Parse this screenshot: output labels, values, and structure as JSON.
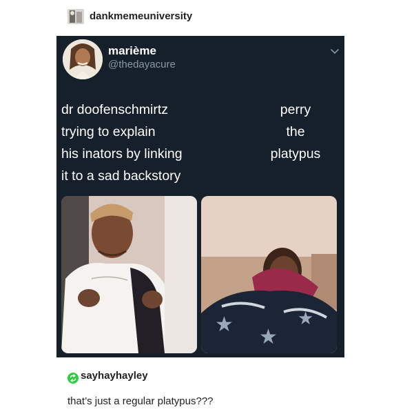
{
  "blog": {
    "name": "dankmemeuniversity"
  },
  "tweet": {
    "display_name": "marième",
    "handle": "@thedayacure",
    "left_lines": [
      "dr doofenschmirtz",
      "trying to explain",
      "his inators by linking",
      "it to a sad backstory"
    ],
    "right_lines": [
      "perry",
      "the",
      "platypus"
    ],
    "chevron_icon": "chevron-down-icon",
    "colors": {
      "card_background": "#15202b",
      "text": "#ffffff",
      "handle": "#8899a6"
    }
  },
  "reblog": {
    "username": "sayhayhayley",
    "comment": "that’s just a regular platypus???",
    "icon": "reblog-icon",
    "icon_color": "#2ecc40"
  }
}
